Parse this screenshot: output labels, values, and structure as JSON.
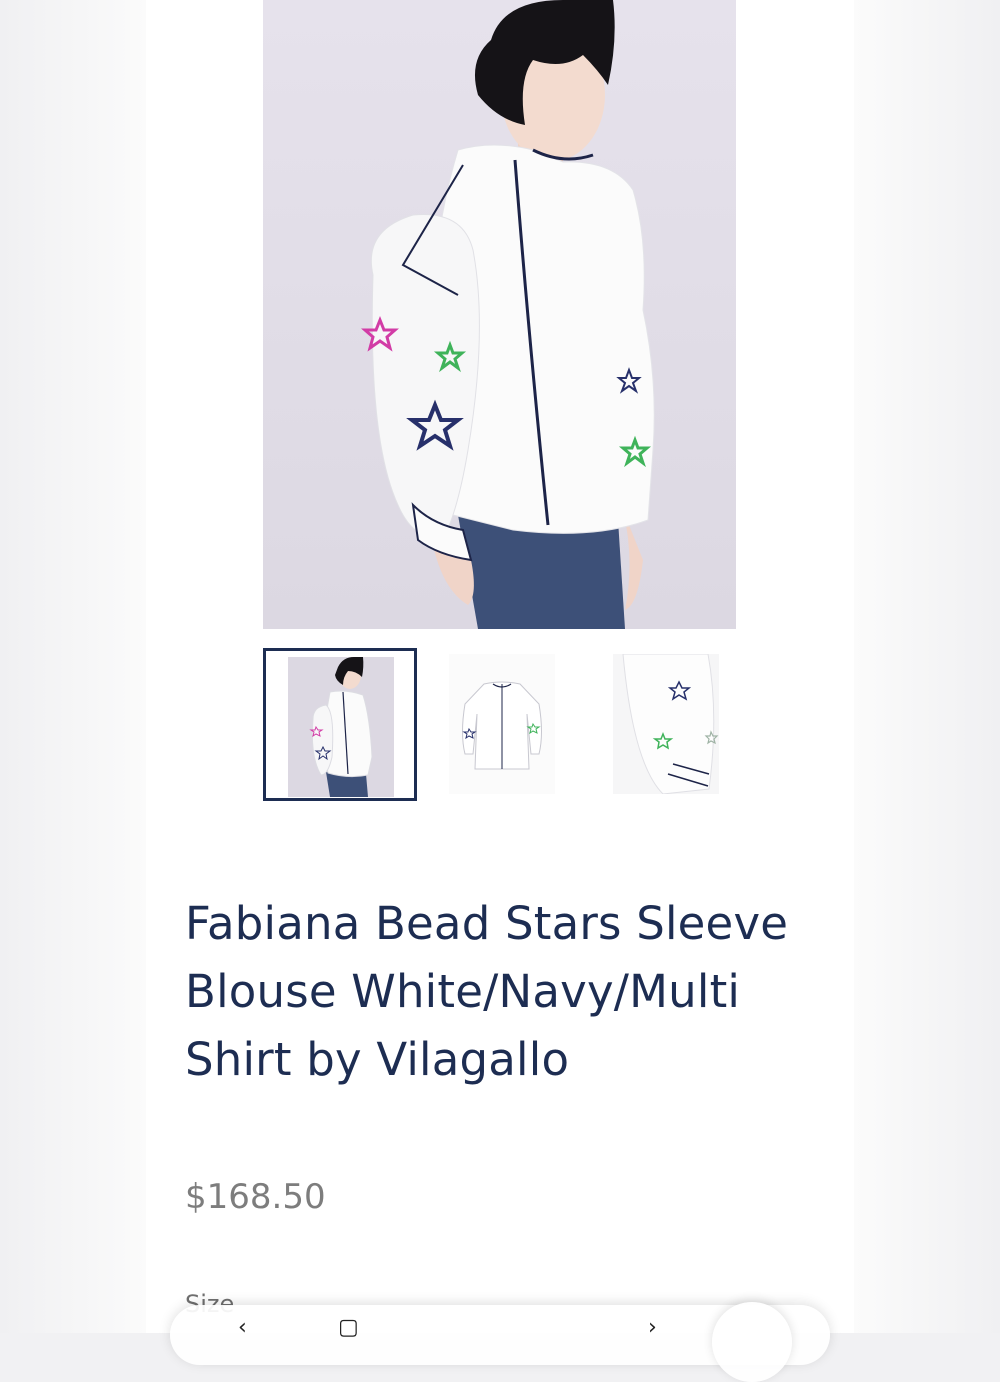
{
  "product": {
    "title": "Fabiana Bead Stars Sleeve Blouse White/Navy/Multi Shirt by Vilagallo",
    "price": "$168.50",
    "size_label": "Size"
  },
  "gallery": {
    "selected_index": 0,
    "thumbnails": [
      "model-front",
      "flat-lay",
      "sleeve-detail"
    ]
  },
  "browser_nav": {
    "back_icon": "‹",
    "tabs_icon": "▢",
    "forward_icon": "›"
  },
  "colors": {
    "title": "#1d2d52",
    "price": "#7d7d7d",
    "thumb_border": "#1d2d52",
    "star_navy": "#27306b",
    "star_pink": "#d23ca6",
    "star_green": "#3fb35a"
  }
}
